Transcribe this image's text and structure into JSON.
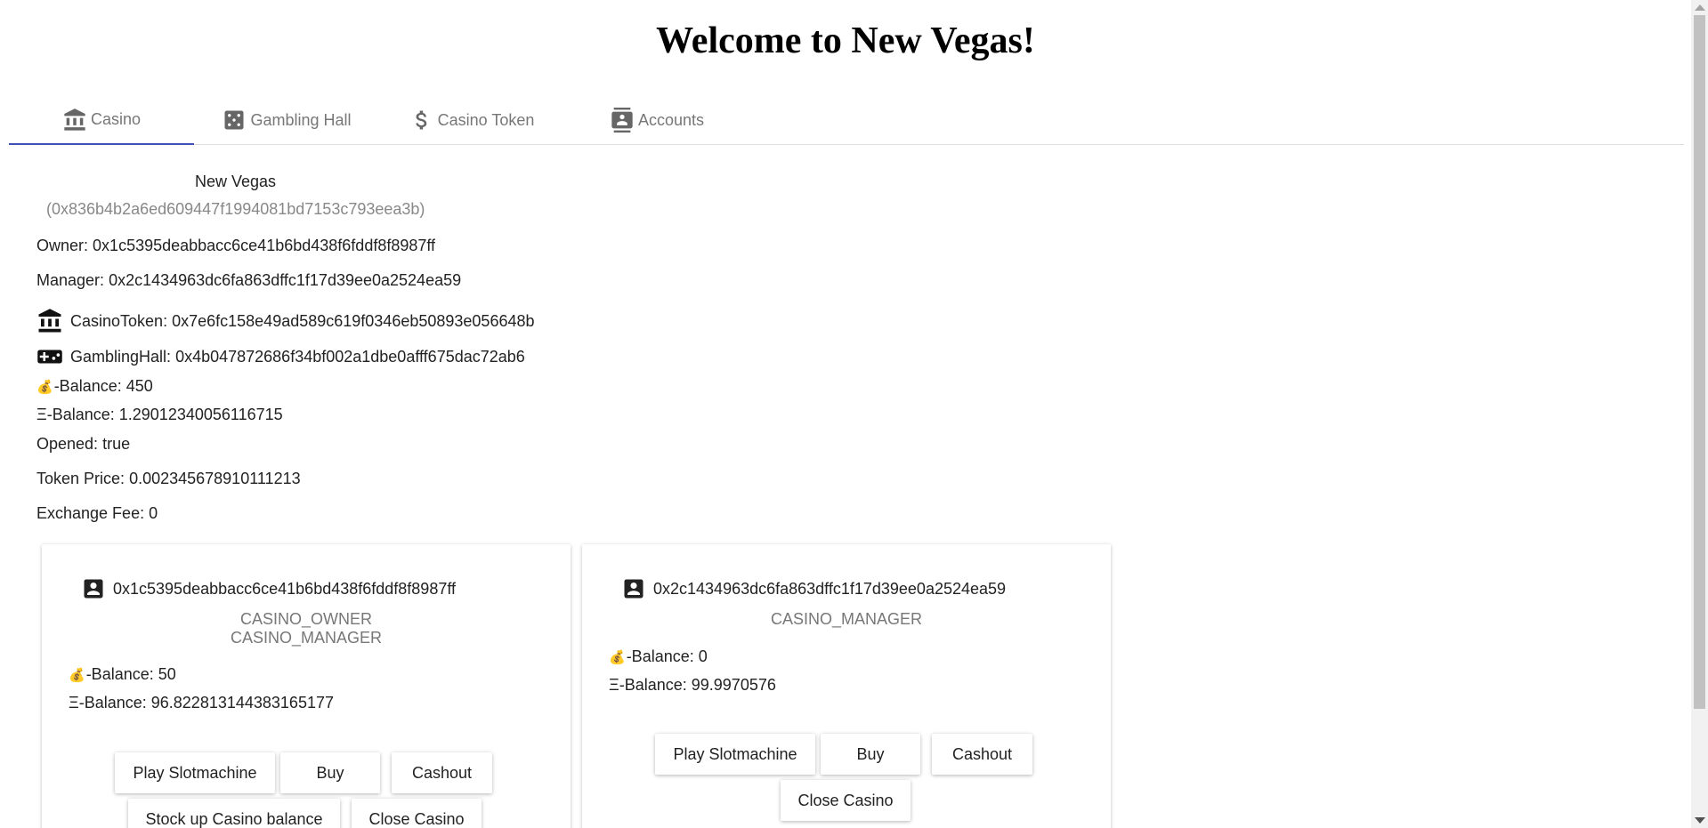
{
  "page_title": "Welcome to New Vegas!",
  "tabs": [
    {
      "label": "Casino",
      "icon": "bank-icon",
      "active": true
    },
    {
      "label": "Gambling Hall",
      "icon": "dice-icon"
    },
    {
      "label": "Casino Token",
      "icon": "dollar-icon"
    },
    {
      "label": "Accounts",
      "icon": "contacts-icon"
    }
  ],
  "casino": {
    "name": "New Vegas",
    "address": "(0x836b4b2a6ed609447f1994081bd7153c793eea3b)",
    "owner_label": "Owner:",
    "owner": "0x1c5395deabbacc6ce41b6bd438f6fddf8f8987ff",
    "manager_label": "Manager:",
    "manager": "0x2c1434963dc6fa863dffc1f17d39ee0a2524ea59",
    "token_label": "CasinoToken:",
    "token": "0x7e6fc158e49ad589c619f0346eb50893e056648b",
    "hall_label": "GamblingHall:",
    "hall": "0x4b047872686f34bf002a1dbe0afff675dac72ab6",
    "token_balance_label": "-Balance:",
    "token_balance": "450",
    "eth_balance_label": "Ξ-Balance:",
    "eth_balance": "1.29012340056116715",
    "opened_label": "Opened:",
    "opened": "true",
    "price_label": "Token Price:",
    "price": "0.002345678910111213",
    "fee_label": "Exchange Fee:",
    "fee": "0"
  },
  "bag_glyph": "💰",
  "accounts": [
    {
      "address": "0x1c5395deabbacc6ce41b6bd438f6fddf8f8987ff",
      "roles": [
        "CASINO_OWNER",
        "CASINO_MANAGER"
      ],
      "token_balance_label": "-Balance:",
      "token_balance": "50",
      "eth_balance_label": "Ξ-Balance:",
      "eth_balance": "96.822813144383165177",
      "buttons": [
        "Play Slotmachine",
        "Buy",
        "Cashout",
        "Stock up Casino balance",
        "Close Casino"
      ]
    },
    {
      "address": "0x2c1434963dc6fa863dffc1f17d39ee0a2524ea59",
      "roles": [
        "CASINO_MANAGER"
      ],
      "token_balance_label": "-Balance:",
      "token_balance": "0",
      "eth_balance_label": "Ξ-Balance:",
      "eth_balance": "99.9970576",
      "buttons": [
        "Play Slotmachine",
        "Buy",
        "Cashout",
        "Close Casino"
      ]
    }
  ]
}
